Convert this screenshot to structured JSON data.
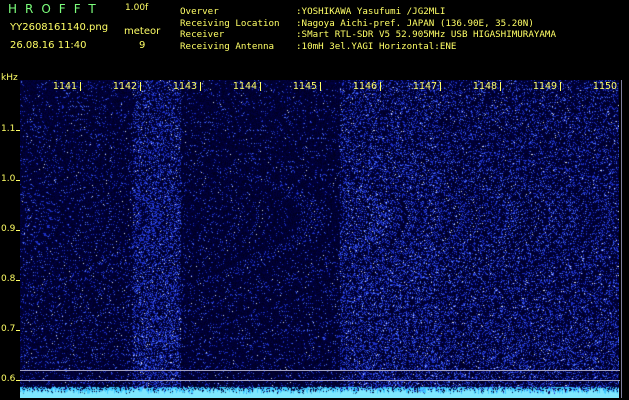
{
  "header": {
    "app_logo": "HROFFT",
    "version": "1.00f",
    "filename": "YY2608161140.png",
    "timestamp": "26.08.16 11:40",
    "meteor_label": "meteor",
    "meteor_count": "9"
  },
  "info": [
    {
      "label": "Overver",
      "value": ":YOSHIKAWA Yasufumi /JG2MLI"
    },
    {
      "label": "Receiving Location",
      "value": ":Nagoya Aichi-pref. JAPAN (136.90E, 35.20N)"
    },
    {
      "label": "Receiver",
      "value": ":SMart RTL-SDR V5 52.905MHz USB HIGASHIMURAYAMA"
    },
    {
      "label": "Receiving Antenna",
      "value": ":10mH 3el.YAGI Horizontal:ENE"
    }
  ],
  "axes": {
    "y_unit": "kHz",
    "y_ticks": [
      "1.1",
      "1.0",
      "0.9",
      "0.8",
      "0.7",
      "0.6"
    ],
    "x_ticks": [
      "1141",
      "1142",
      "1143",
      "1144",
      "1145",
      "1146",
      "1147",
      "1148",
      "1149",
      "1150"
    ]
  },
  "colors": {
    "label_yellow": "#FFFF66",
    "logo_green": "#7CFF7C",
    "background": "#000000",
    "spectrogram_blue": "#1010A0",
    "noise_cyan": "#40E0FF"
  }
}
